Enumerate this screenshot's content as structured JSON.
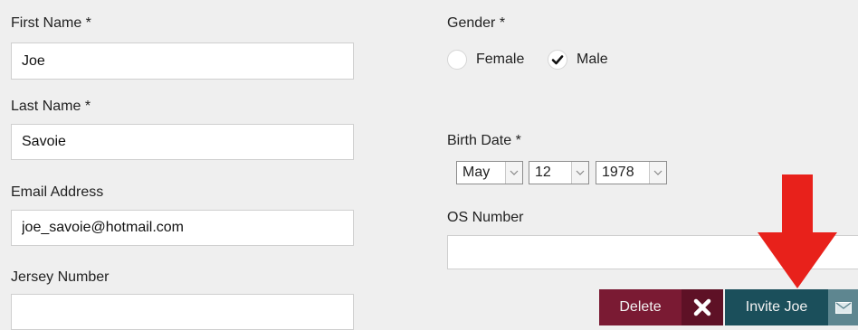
{
  "form": {
    "first_name": {
      "label": "First Name *",
      "value": "Joe"
    },
    "last_name": {
      "label": "Last Name *",
      "value": "Savoie"
    },
    "email": {
      "label": "Email Address",
      "value": "joe_savoie@hotmail.com"
    },
    "jersey": {
      "label": "Jersey Number",
      "value": ""
    },
    "gender": {
      "label": "Gender *",
      "options": [
        {
          "label": "Female",
          "checked": false
        },
        {
          "label": "Male",
          "checked": true
        }
      ]
    },
    "birth_date": {
      "label": "Birth Date *",
      "month": "May",
      "day": "12",
      "year": "1978"
    },
    "os_number": {
      "label": "OS Number",
      "value": ""
    }
  },
  "actions": {
    "delete_label": "Delete",
    "invite_label": "Invite Joe"
  },
  "annotation": {
    "arrow_color": "#e8211b"
  },
  "colors": {
    "delete_bg": "#7a1a33",
    "invite_bg": "#1b4f5b"
  }
}
